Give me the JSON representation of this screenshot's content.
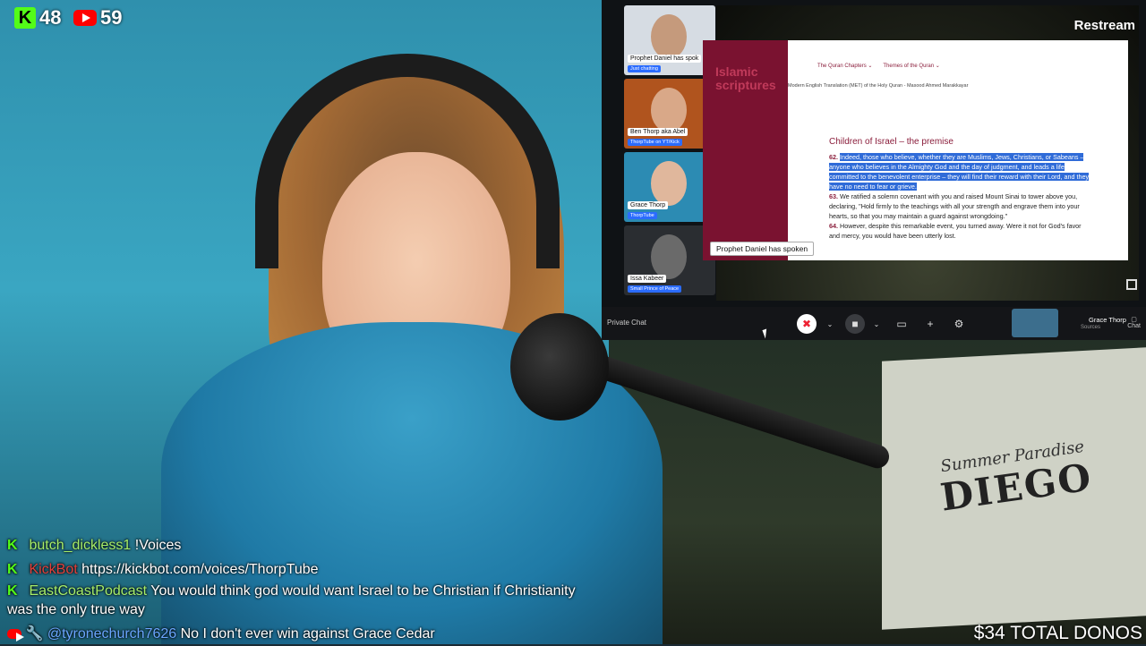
{
  "stats": {
    "kick_viewers": "48",
    "youtube_viewers": "59",
    "kick_logo_text": "K"
  },
  "meeting": {
    "brand": "Restream",
    "participants": [
      {
        "name": "Prophet Daniel has spok",
        "subtitle": "Just chatting"
      },
      {
        "name": "Ben Thorp aka Abel",
        "subtitle": "ThorpTube on YT/Kick"
      },
      {
        "name": "Grace Thorp",
        "subtitle": "ThorpTube"
      },
      {
        "name": "Issa Kabeer",
        "subtitle": "Small Prince of Peace"
      }
    ],
    "shared_screen": {
      "logo": "Islamic scriptures",
      "nav": [
        "The Quran Chapters ⌄",
        "Themes of the Quran ⌄"
      ],
      "translation": "Modern English Translation (MET) of the Holy Quran - Masood Ahmed Marakkayar",
      "heading": "Children of Israel – the premise",
      "v62_num": "62.",
      "v62": "Indeed, those who believe, whether they are Muslims, Jews, Christians, or Sabeans – anyone who believes in the Almighty God and the day of judgment, and leads a life committed to the benevolent enterprise – they will find their reward with their Lord, and they have no need to fear or grieve.",
      "v63_num": "63.",
      "v63": "We ratified a solemn covenant with you and raised Mount Sinai to tower above you, declaring, \"Hold firmly to the teachings with all your strength and engrave them into your hearts, so that you may maintain a guard against wrongdoing.\"",
      "v64_num": "64.",
      "v64": "However, despite this remarkable event, you turned away. Were it not for God's favor and mercy, you would have been utterly lost."
    },
    "spoken_banner": "Prophet Daniel has spoken",
    "bar": {
      "private_chat": "Private Chat",
      "host_name": "Grace Thorp",
      "host_sub": "Sources",
      "chat_label": "Chat"
    }
  },
  "chat": [
    {
      "platform": "kick",
      "user": "butch_dickless1",
      "text": "!Voices"
    },
    {
      "platform": "kick",
      "user": "KickBot",
      "text": "https://kickbot.com/voices/ThorpTube"
    },
    {
      "platform": "kick",
      "user": "EastCoastPodcast",
      "text": "You would think god would want Israel to be Christian if Christianity was the only true way"
    },
    {
      "platform": "youtube",
      "user": "@tyronechurch7626",
      "text": "No I don't ever win against Grace Cedar"
    }
  ],
  "donations": "$34 TOTAL DONOS",
  "colors": {
    "kick": "#53fc18",
    "youtube": "#ff0000",
    "quran_accent": "#7a1230",
    "highlight": "#2f6bd8"
  }
}
